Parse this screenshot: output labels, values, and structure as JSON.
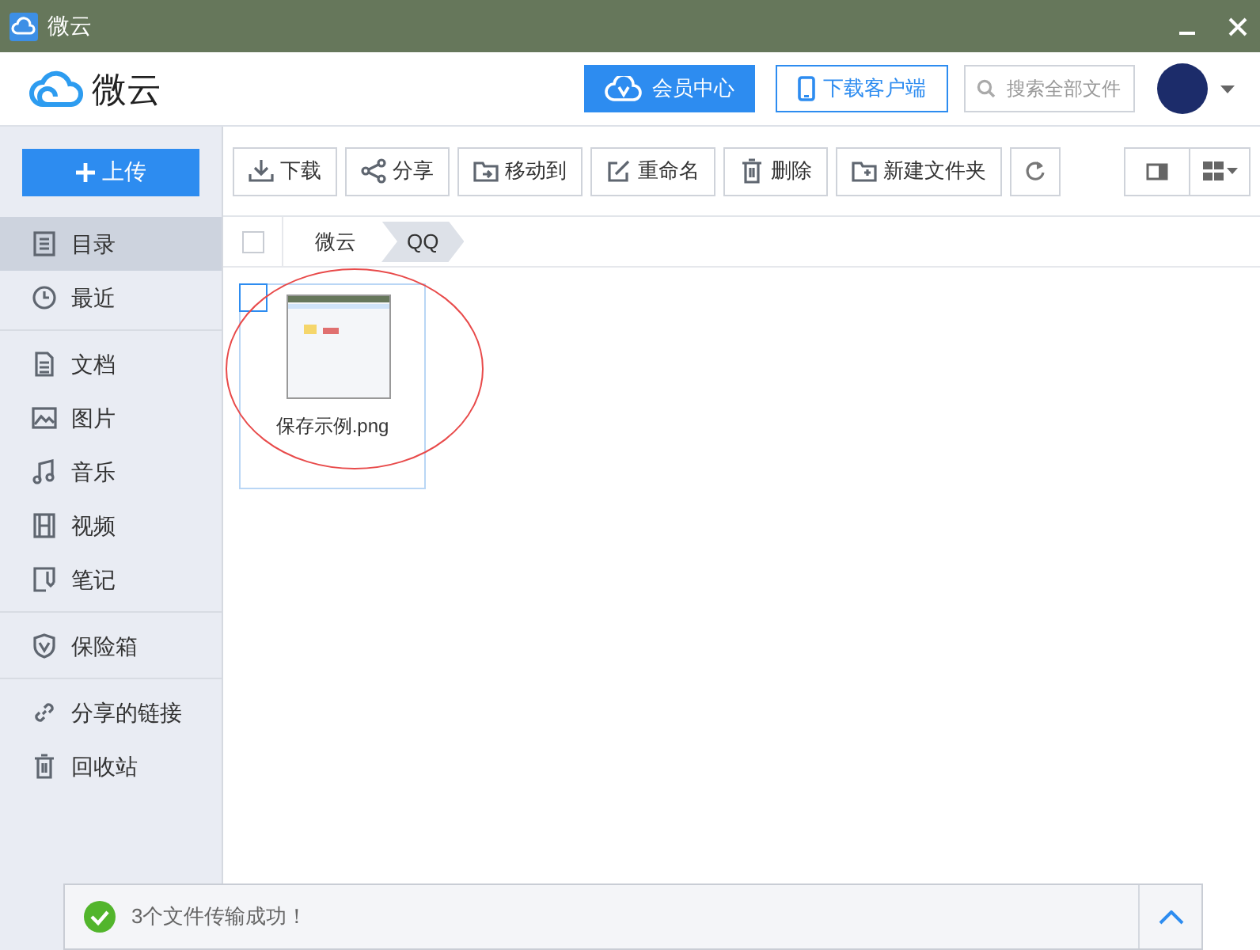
{
  "window": {
    "title": "微云"
  },
  "header": {
    "logo_text": "微云",
    "vip_button": "会员中心",
    "download_client_button": "下载客户端",
    "search": {
      "placeholder": "搜索全部文件"
    }
  },
  "upload_button": "上传",
  "sidebar": {
    "groups": [
      [
        {
          "label": "目录",
          "selected": true
        },
        {
          "label": "最近",
          "selected": false
        }
      ],
      [
        {
          "label": "文档",
          "selected": false
        },
        {
          "label": "图片",
          "selected": false
        },
        {
          "label": "音乐",
          "selected": false
        },
        {
          "label": "视频",
          "selected": false
        },
        {
          "label": "笔记",
          "selected": false
        }
      ],
      [
        {
          "label": "保险箱",
          "selected": false
        }
      ],
      [
        {
          "label": "分享的链接",
          "selected": false
        },
        {
          "label": "回收站",
          "selected": false
        }
      ]
    ]
  },
  "toolbar": [
    "下载",
    "分享",
    "移动到",
    "重命名",
    "删除",
    "新建文件夹"
  ],
  "breadcrumb": [
    {
      "label": "微云",
      "selected": false
    },
    {
      "label": "QQ",
      "selected": true
    }
  ],
  "select_all_checked": false,
  "files": [
    {
      "name": "保存示例.png",
      "checked": false,
      "hovered": true
    }
  ],
  "notification": {
    "text": "3个文件传输成功！"
  }
}
